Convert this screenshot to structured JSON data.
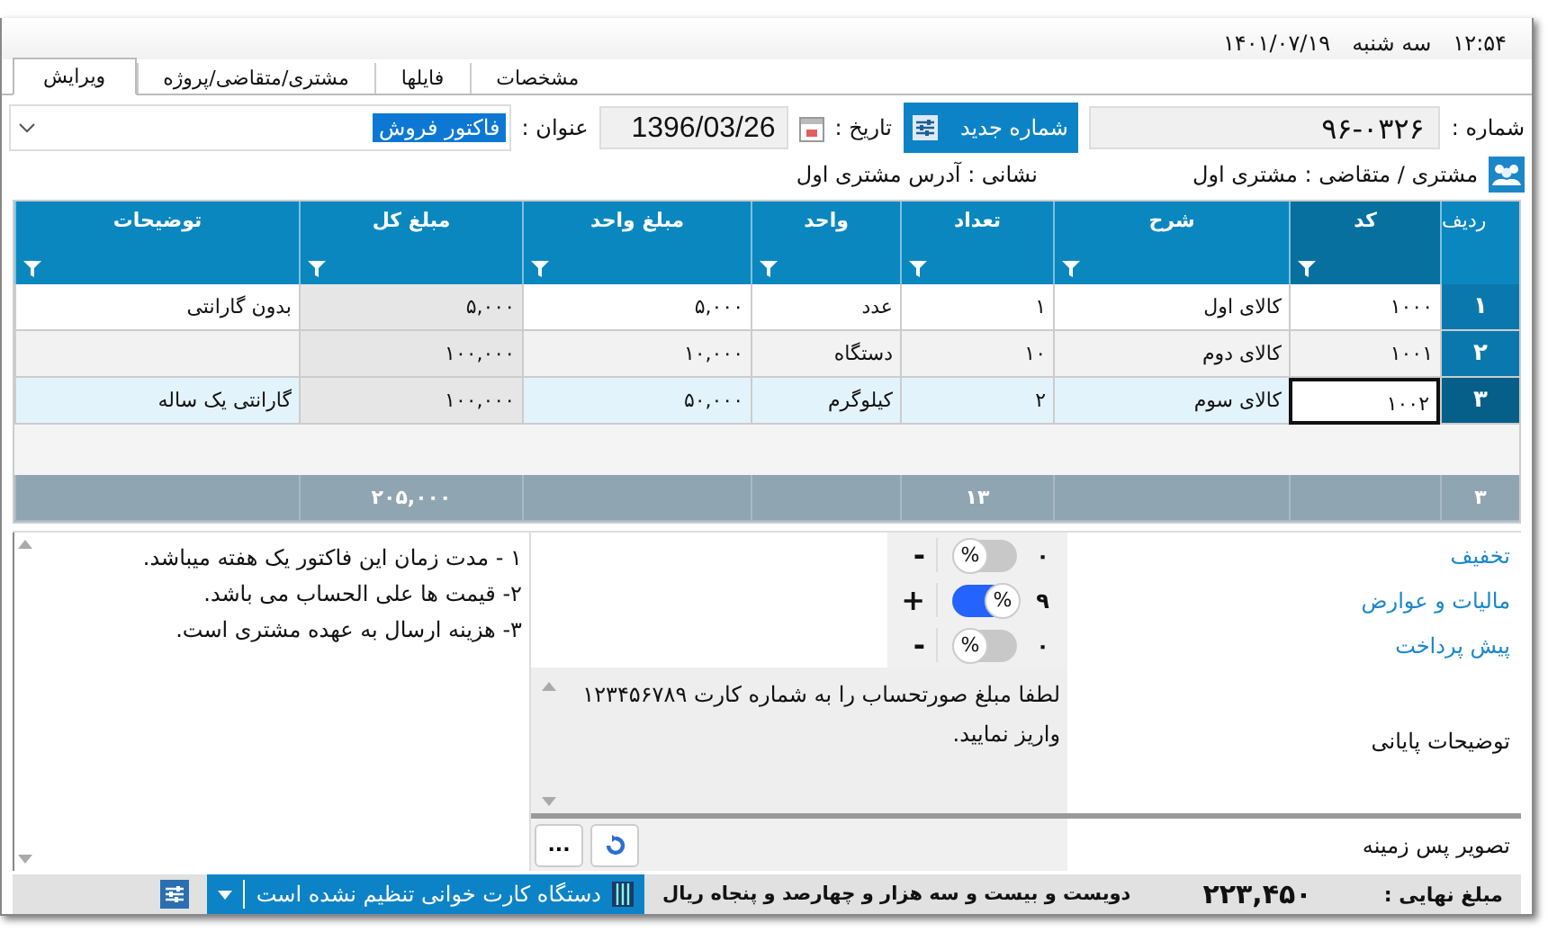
{
  "clock": {
    "time": "۱۲:۵۴",
    "day": "سه شنبه",
    "date": "۱۴۰۱/۰۷/۱۹"
  },
  "tabs": [
    {
      "label": "مشخصات",
      "selected": false
    },
    {
      "label": "فایلها",
      "selected": false
    },
    {
      "label": "مشتری/متقاضی/پروژه",
      "selected": false
    },
    {
      "label": "ویرایش",
      "selected": true
    }
  ],
  "header": {
    "number_label": "شماره :",
    "number": "۹۶-۰۳۲۶",
    "new_number_button": "شماره جدید",
    "date_label": "تاریخ :",
    "date": "1396/03/26",
    "title_label": "عنوان :",
    "title_value": "فاکتور فروش",
    "customer": "مشتری / متقاضی :  مشتری اول",
    "address": "نشانی : آدرس مشتری اول"
  },
  "table": {
    "columns": [
      "ردیف",
      "کد",
      "شرح",
      "تعداد",
      "واحد",
      "مبلغ واحد",
      "مبلغ کل",
      "توضیحات"
    ],
    "rows": [
      {
        "index": "۱",
        "code": "۱۰۰۰",
        "description": "کالای اول",
        "quantity": "۱",
        "unit": "عدد",
        "unit_price": "۵,۰۰۰",
        "total": "۵,۰۰۰",
        "notes": "بدون گارانتی",
        "selected": false
      },
      {
        "index": "۲",
        "code": "۱۰۰۱",
        "description": "کالای دوم",
        "quantity": "۱۰",
        "unit": "دستگاه",
        "unit_price": "۱۰,۰۰۰",
        "total": "۱۰۰,۰۰۰",
        "selected": false
      },
      {
        "index": "۳",
        "code": "۱۰۰۲",
        "description": "کالای سوم",
        "quantity": "۲",
        "unit": "کیلوگرم",
        "unit_price": "۵۰,۰۰۰",
        "total": "۱۰۰,۰۰۰",
        "notes": "گارانتی یک ساله",
        "selected": true
      }
    ],
    "footer": {
      "row_count": "۳",
      "quantity": "۱۳",
      "total": "۲۰۵,۰۰۰"
    }
  },
  "adjustments": [
    {
      "label": "تخفیف",
      "value": "۰",
      "unit": "%",
      "on": false,
      "sign": "-"
    },
    {
      "label": "مالیات و عوارض",
      "value": "۹",
      "unit": "%",
      "on": true,
      "sign": "+"
    },
    {
      "label": "پیش پرداخت",
      "value": "۰",
      "unit": "%",
      "on": false,
      "sign": "-"
    }
  ],
  "closing_note": {
    "label": "توضیحات پایانی",
    "text": "لطفا مبلغ صورتحساب را به شماره کارت ۱۲۳۴۵۶۷۸۹ واریز نمایید."
  },
  "background_image": {
    "label": "تصویر پس زمینه",
    "browse_button": "..."
  },
  "terms": [
    "۱ - مدت زمان این فاکتور یک هفته میباشد.",
    "۲- قیمت ها علی الحساب می باشد.",
    "۳- هزینه ارسال به عهده مشتری است."
  ],
  "status_bar": {
    "final_label": "مبلغ نهایی :",
    "final_amount": "۲۲۳,۴۵۰",
    "amount_in_words": "دویست و بیست و سه هزار و چهارصد و پنجاه ریال",
    "card_reader": "دستگاه کارت خوانی تنظیم نشده است"
  }
}
